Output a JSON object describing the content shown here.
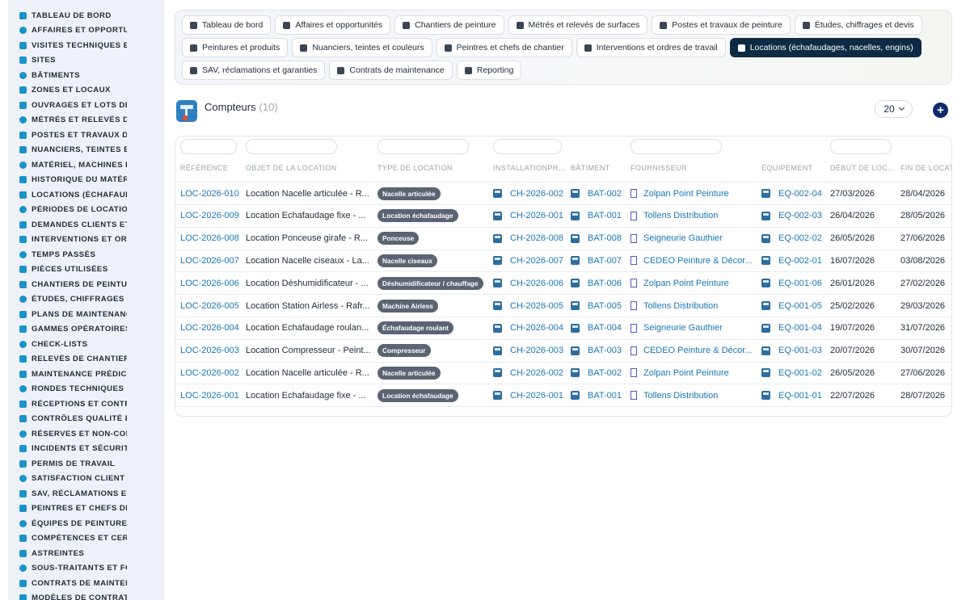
{
  "sidebar": {
    "items": [
      {
        "label": "TABLEAU DE BORD",
        "icon": "dashboard-icon"
      },
      {
        "label": "AFFAIRES ET OPPORTUNITÉS",
        "icon": "target-icon"
      },
      {
        "label": "VISITES TECHNIQUES ET DIAGNOSTICS",
        "icon": "clipboard-icon"
      },
      {
        "label": "SITES",
        "icon": "map-pin-icon"
      },
      {
        "label": "BÂTIMENTS",
        "icon": "building-icon"
      },
      {
        "label": "ZONES ET LOCAUX",
        "icon": "grid-icon"
      },
      {
        "label": "OUVRAGES ET LOTS DE TRAVAUX",
        "icon": "sitemap-icon"
      },
      {
        "label": "MÉTRÉS ET RELEVÉS DE SURFACES",
        "icon": "ruler-icon"
      },
      {
        "label": "POSTES ET TRAVAUX DE PEINTURE",
        "icon": "paint-roller-icon"
      },
      {
        "label": "NUANCIERS, TEINTES ET COULEURS",
        "icon": "palette-icon"
      },
      {
        "label": "MATÉRIEL, MACHINES ET OUTILLAGE",
        "icon": "gears-icon"
      },
      {
        "label": "HISTORIQUE DU MATÉRIEL",
        "icon": "history-icon"
      },
      {
        "label": "LOCATIONS (ÉCHAFAUDAGES, NACELLES, ENGINS)",
        "icon": "truck-icon"
      },
      {
        "label": "PÉRIODES DE LOCATION",
        "icon": "calendar-icon"
      },
      {
        "label": "DEMANDES CLIENTS ET INTERVENTIONS",
        "icon": "question-icon"
      },
      {
        "label": "INTERVENTIONS ET ORDRES DE TRAVAIL",
        "icon": "wrench-icon"
      },
      {
        "label": "TEMPS PASSÉS",
        "icon": "clock-icon"
      },
      {
        "label": "PIÈCES UTILISÉES",
        "icon": "box-icon"
      },
      {
        "label": "CHANTIERS DE PEINTURE",
        "icon": "brush-icon"
      },
      {
        "label": "ÉTUDES, CHIFFRAGES ET DEVIS",
        "icon": "people-icon"
      },
      {
        "label": "PLANS DE MAINTENANCE",
        "icon": "calendar-check-icon"
      },
      {
        "label": "GAMMES OPÉRATOIRES",
        "icon": "list-icon"
      },
      {
        "label": "CHECK-LISTS",
        "icon": "checklist-icon"
      },
      {
        "label": "RELEVÉS DE CHANTIER",
        "icon": "document-icon"
      },
      {
        "label": "MAINTENANCE PRÉDICTIVE",
        "icon": "chart-line-icon"
      },
      {
        "label": "RONDES TECHNIQUES",
        "icon": "route-icon"
      },
      {
        "label": "RÉCEPTIONS ET CONTRÔLES",
        "icon": "search-icon"
      },
      {
        "label": "CONTRÔLES QUALITÉ ET CONFORMITÉ",
        "icon": "clipboard-check-icon"
      },
      {
        "label": "RÉSERVES ET NON-CONFORMITÉS",
        "icon": "alert-circle-icon"
      },
      {
        "label": "INCIDENTS ET SÉCURITÉ",
        "icon": "warning-icon"
      },
      {
        "label": "PERMIS DE TRAVAIL",
        "icon": "pen-icon"
      },
      {
        "label": "SATISFACTION CLIENT",
        "icon": "smile-icon"
      },
      {
        "label": "SAV, RÉCLAMATIONS ET GARANTIES",
        "icon": "chat-icon"
      },
      {
        "label": "PEINTRES ET CHEFS DE CHANTIER",
        "icon": "helmet-icon"
      },
      {
        "label": "ÉQUIPES DE PEINTURE",
        "icon": "team-icon"
      },
      {
        "label": "COMPÉTENCES ET CERTIFICATIONS",
        "icon": "medal-icon"
      },
      {
        "label": "ASTREINTES",
        "icon": "user-icon"
      },
      {
        "label": "SOUS-TRAITANTS ET FOURNISSEURS",
        "icon": "handshake-icon"
      },
      {
        "label": "CONTRATS DE MAINTENANCE",
        "icon": "file-contract-icon"
      },
      {
        "label": "MODÈLES DE CONTRATS",
        "icon": "file-icon"
      }
    ]
  },
  "tabs": {
    "rows": [
      [
        {
          "label": "Tableau de bord",
          "icon": "dashboard-icon",
          "active": false
        },
        {
          "label": "Affaires et opportunités",
          "icon": "target-icon",
          "active": false
        },
        {
          "label": "Chantiers de peinture",
          "icon": "brush-icon",
          "active": false
        },
        {
          "label": "Métrés et relevés de surfaces",
          "icon": "ruler-icon",
          "active": false
        },
        {
          "label": "Postes et travaux de peinture",
          "icon": "paint-roller-icon",
          "active": false
        },
        {
          "label": "Études, chiffrages et devis",
          "icon": "people-icon",
          "active": false
        }
      ],
      [
        {
          "label": "Peintures et produits",
          "icon": "bucket-icon",
          "active": false
        },
        {
          "label": "Nuanciers, teintes et couleurs",
          "icon": "palette-icon",
          "active": false
        },
        {
          "label": "Peintres et chefs de chantier",
          "icon": "helmet-icon",
          "active": false
        },
        {
          "label": "Interventions et ordres de travail",
          "icon": "clipboard-icon",
          "active": false
        },
        {
          "label": "Locations (échafaudages, nacelles, engins)",
          "icon": "truck-icon",
          "active": true
        }
      ],
      [
        {
          "label": "SAV, réclamations et garanties",
          "icon": "chat-icon",
          "active": false
        },
        {
          "label": "Contrats de maintenance",
          "icon": "file-contract-icon",
          "active": false
        },
        {
          "label": "Reporting",
          "icon": "pie-chart-icon",
          "active": false
        }
      ]
    ]
  },
  "header": {
    "title": "Compteurs",
    "count": "(10)",
    "page_size": "20",
    "add_label": "+"
  },
  "colors": {
    "accent": "#1a76b8",
    "active_tab": "#0d2b45",
    "badge": "#5a6472",
    "add_button": "#0d2b6b"
  },
  "table": {
    "columns": [
      "RÉFÉRENCE",
      "OBJET DE LA LOCATION",
      "TYPE DE LOCATION",
      "INSTALLATIONPR...",
      "BÂTIMENT",
      "FOURNISSEUR",
      "ÉQUIPEMENT",
      "DÉBUT DE LOC...",
      "FIN DE LOCATION"
    ],
    "rows": [
      {
        "ref": "LOC-2026-010",
        "objet": "Location Nacelle articulée - R...",
        "type": "Nacelle articulée",
        "chantier": "CH-2026-002",
        "batiment": "BAT-002",
        "fournisseur": "Zolpan Point Peinture",
        "equipement": "EQ-002-04",
        "debut": "27/03/2026",
        "fin": "28/04/2026"
      },
      {
        "ref": "LOC-2026-009",
        "objet": "Location Echafaudage fixe - ...",
        "type": "Location échafaudage",
        "chantier": "CH-2026-001",
        "batiment": "BAT-001",
        "fournisseur": "Tollens Distribution",
        "equipement": "EQ-002-03",
        "debut": "26/04/2026",
        "fin": "28/05/2026"
      },
      {
        "ref": "LOC-2026-008",
        "objet": "Location Ponceuse girafe - R...",
        "type": "Ponceuse",
        "chantier": "CH-2026-008",
        "batiment": "BAT-008",
        "fournisseur": "Seigneurie Gauthier",
        "equipement": "EQ-002-02",
        "debut": "26/05/2026",
        "fin": "27/06/2026"
      },
      {
        "ref": "LOC-2026-007",
        "objet": "Location Nacelle ciseaux - La...",
        "type": "Nacelle ciseaux",
        "chantier": "CH-2026-007",
        "batiment": "BAT-007",
        "fournisseur": "CEDEO Peinture & Décor...",
        "equipement": "EQ-002-01",
        "debut": "16/07/2026",
        "fin": "03/08/2026"
      },
      {
        "ref": "LOC-2026-006",
        "objet": "Location Déshumidificateur - ...",
        "type": "Déshumidificateur / chauffage",
        "chantier": "CH-2026-006",
        "batiment": "BAT-006",
        "fournisseur": "Zolpan Point Peinture",
        "equipement": "EQ-001-06",
        "debut": "26/01/2026",
        "fin": "27/02/2026"
      },
      {
        "ref": "LOC-2026-005",
        "objet": "Location Station Airless - Rafr...",
        "type": "Machine Airless",
        "chantier": "CH-2026-005",
        "batiment": "BAT-005",
        "fournisseur": "Tollens Distribution",
        "equipement": "EQ-001-05",
        "debut": "25/02/2026",
        "fin": "29/03/2026"
      },
      {
        "ref": "LOC-2026-004",
        "objet": "Location Echafaudage roulan...",
        "type": "Échafaudage roulant",
        "chantier": "CH-2026-004",
        "batiment": "BAT-004",
        "fournisseur": "Seigneurie Gauthier",
        "equipement": "EQ-001-04",
        "debut": "19/07/2026",
        "fin": "31/07/2026"
      },
      {
        "ref": "LOC-2026-003",
        "objet": "Location Compresseur - Peint...",
        "type": "Compresseur",
        "chantier": "CH-2026-003",
        "batiment": "BAT-003",
        "fournisseur": "CEDEO Peinture & Décor...",
        "equipement": "EQ-001-03",
        "debut": "20/07/2026",
        "fin": "30/07/2026"
      },
      {
        "ref": "LOC-2026-002",
        "objet": "Location Nacelle articulée - R...",
        "type": "Nacelle articulée",
        "chantier": "CH-2026-002",
        "batiment": "BAT-002",
        "fournisseur": "Zolpan Point Peinture",
        "equipement": "EQ-001-02",
        "debut": "26/05/2026",
        "fin": "27/06/2026"
      },
      {
        "ref": "LOC-2026-001",
        "objet": "Location Echafaudage fixe - ...",
        "type": "Location échafaudage",
        "chantier": "CH-2026-001",
        "batiment": "BAT-001",
        "fournisseur": "Tollens Distribution",
        "equipement": "EQ-001-01",
        "debut": "22/07/2026",
        "fin": "28/07/2026"
      }
    ]
  }
}
